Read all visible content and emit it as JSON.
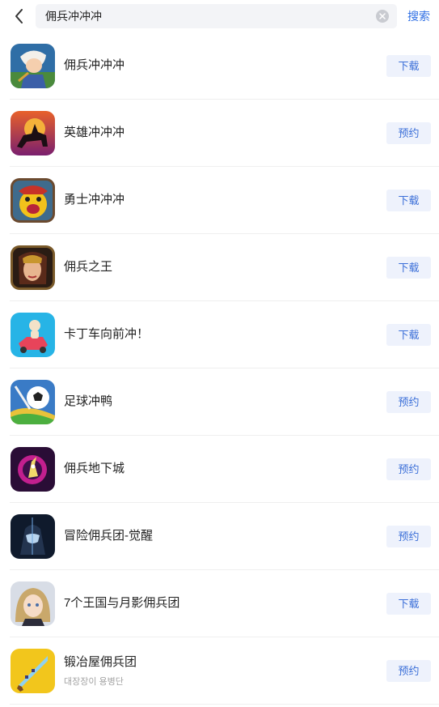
{
  "search": {
    "query": "佣兵冲冲冲",
    "button_label": "搜索"
  },
  "colors": {
    "accent": "#3b6fd8",
    "button_bg": "#eef2fc",
    "search_bg": "#f3f4f7"
  },
  "results": [
    {
      "name": "佣兵冲冲冲",
      "action": "下载",
      "icon": "mercenary-hero-icon"
    },
    {
      "name": "英雄冲冲冲",
      "action": "预约",
      "icon": "horse-rider-icon"
    },
    {
      "name": "勇士冲冲冲",
      "action": "下载",
      "icon": "monster-warrior-icon"
    },
    {
      "name": "佣兵之王",
      "action": "下载",
      "icon": "warrior-queen-icon"
    },
    {
      "name": "卡丁车向前冲！",
      "action": "下载",
      "icon": "kart-icon"
    },
    {
      "name": "足球冲鸭",
      "action": "预约",
      "icon": "soccer-ball-icon"
    },
    {
      "name": "佣兵地下城",
      "action": "预约",
      "icon": "dungeon-sword-icon"
    },
    {
      "name": "冒险佣兵团-觉醒",
      "action": "预约",
      "icon": "masked-hero-icon"
    },
    {
      "name": "7个王国与月影佣兵团",
      "action": "下载",
      "icon": "anime-girl-icon"
    },
    {
      "name": "锻冶屋佣兵团",
      "subtitle": "대장장이 용병단",
      "action": "预约",
      "icon": "pixel-sword-icon"
    }
  ]
}
